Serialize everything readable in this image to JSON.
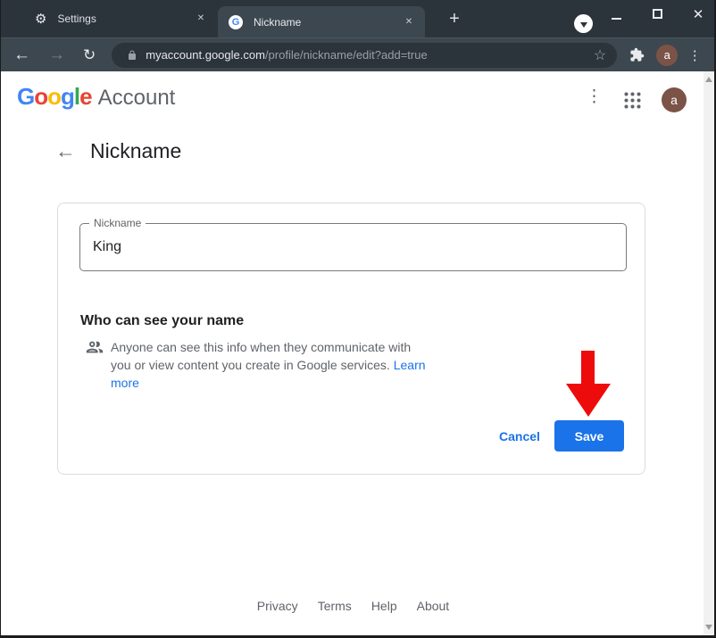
{
  "browser": {
    "tabs": [
      {
        "label": "Settings"
      },
      {
        "label": "Nickname",
        "favicon_letter": "G"
      }
    ],
    "url_host": "myaccount.google.com",
    "url_path": "/profile/nickname/edit?add=true",
    "avatar_letter": "a"
  },
  "header": {
    "logo_letters": [
      "G",
      "o",
      "o",
      "g",
      "l",
      "e"
    ],
    "product": "Account",
    "avatar_letter": "a"
  },
  "page": {
    "title": "Nickname"
  },
  "card": {
    "field_label": "Nickname",
    "field_value": "King",
    "section_title": "Who can see your name",
    "info_line1": "Anyone can see this info when they communicate with",
    "info_line2": "you or view content you create in Google services.",
    "link_word1": "Learn",
    "link_word2": "more",
    "cancel_label": "Cancel",
    "save_label": "Save"
  },
  "footer": {
    "links": [
      "Privacy",
      "Terms",
      "Help",
      "About"
    ]
  },
  "colors": {
    "accent_blue": "#1a73e8",
    "annotation_red": "#ee0000",
    "google_blue": "#4285F4",
    "google_red": "#EA4335",
    "google_yellow": "#FBBC05",
    "google_green": "#34A853",
    "avatar_brown": "#7b5347",
    "frame_dark": "#2b333b",
    "toolbar_dark": "#3d4750"
  }
}
